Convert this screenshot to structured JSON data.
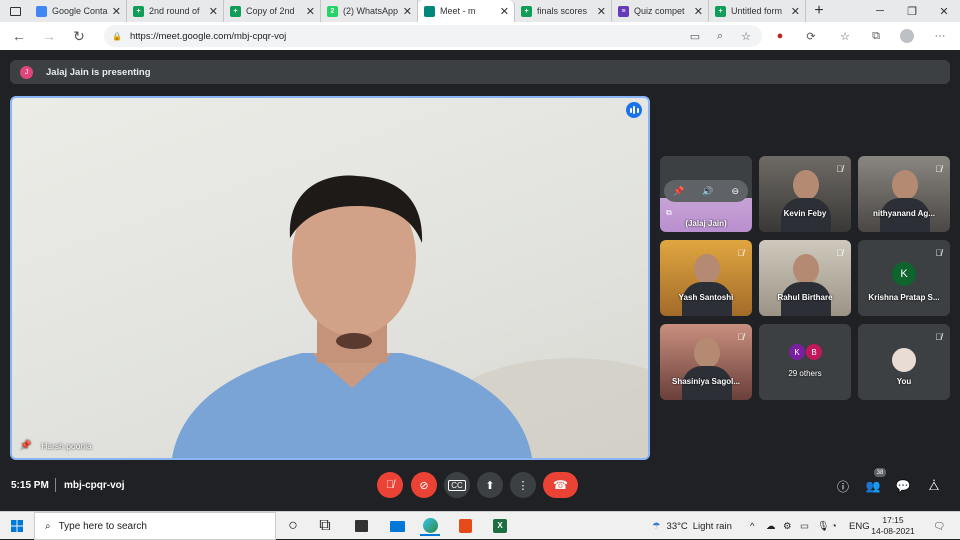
{
  "browser": {
    "tabs": [
      {
        "title": "Google Conta",
        "fav": "#4285f4",
        "glyph": ""
      },
      {
        "title": "2nd round of",
        "fav": "#0f9d58",
        "glyph": "+"
      },
      {
        "title": "Copy of 2nd",
        "fav": "#0f9d58",
        "glyph": "+"
      },
      {
        "title": "(2) WhatsApp",
        "fav": "#25d366",
        "glyph": "2"
      },
      {
        "title": "Meet - m",
        "fav": "#00897b",
        "glyph": "",
        "active": true
      },
      {
        "title": "finals scores",
        "fav": "#0f9d58",
        "glyph": "+"
      },
      {
        "title": "Quiz compet",
        "fav": "#673ab7",
        "glyph": "≡"
      },
      {
        "title": "Untitled form",
        "fav": "#0f9d58",
        "glyph": "+"
      }
    ],
    "close_glyph": "✕",
    "new_tab": "+",
    "url": "https://meet.google.com/mbj-cpqr-voj"
  },
  "meet": {
    "presenting_banner": "Jalaj Jain is presenting",
    "presenter_initial": "J",
    "main_name": "Harsh poonia",
    "tiles": [
      {
        "name": "(Jalaj Jain)",
        "kind": "screen"
      },
      {
        "name": "Kevin Feby",
        "kind": "video"
      },
      {
        "name": "nithyanand Ag...",
        "kind": "video"
      },
      {
        "name": "Yash Santoshi",
        "kind": "video"
      },
      {
        "name": "Rahul Birthare",
        "kind": "video"
      },
      {
        "name": "Krishna Pratap S...",
        "kind": "avatar",
        "initial": "K"
      },
      {
        "name": "Shasiniya Sagol...",
        "kind": "video"
      },
      {
        "name": "29 others",
        "kind": "others",
        "initials": [
          "K",
          "B"
        ]
      },
      {
        "name": "You",
        "kind": "self"
      }
    ],
    "time": "5:15 PM",
    "meeting_code": "mbj-cpqr-voj",
    "people_count": "38",
    "colors": {
      "accent": "#8ab4f8",
      "danger": "#ea4335",
      "surface": "#3c4043"
    }
  },
  "taskbar": {
    "search_placeholder": "Type here to search",
    "weather_temp": "33°C",
    "weather_desc": "Light rain",
    "lang": "ENG",
    "clock_time": "17:15",
    "clock_date": "14-08-2021"
  }
}
